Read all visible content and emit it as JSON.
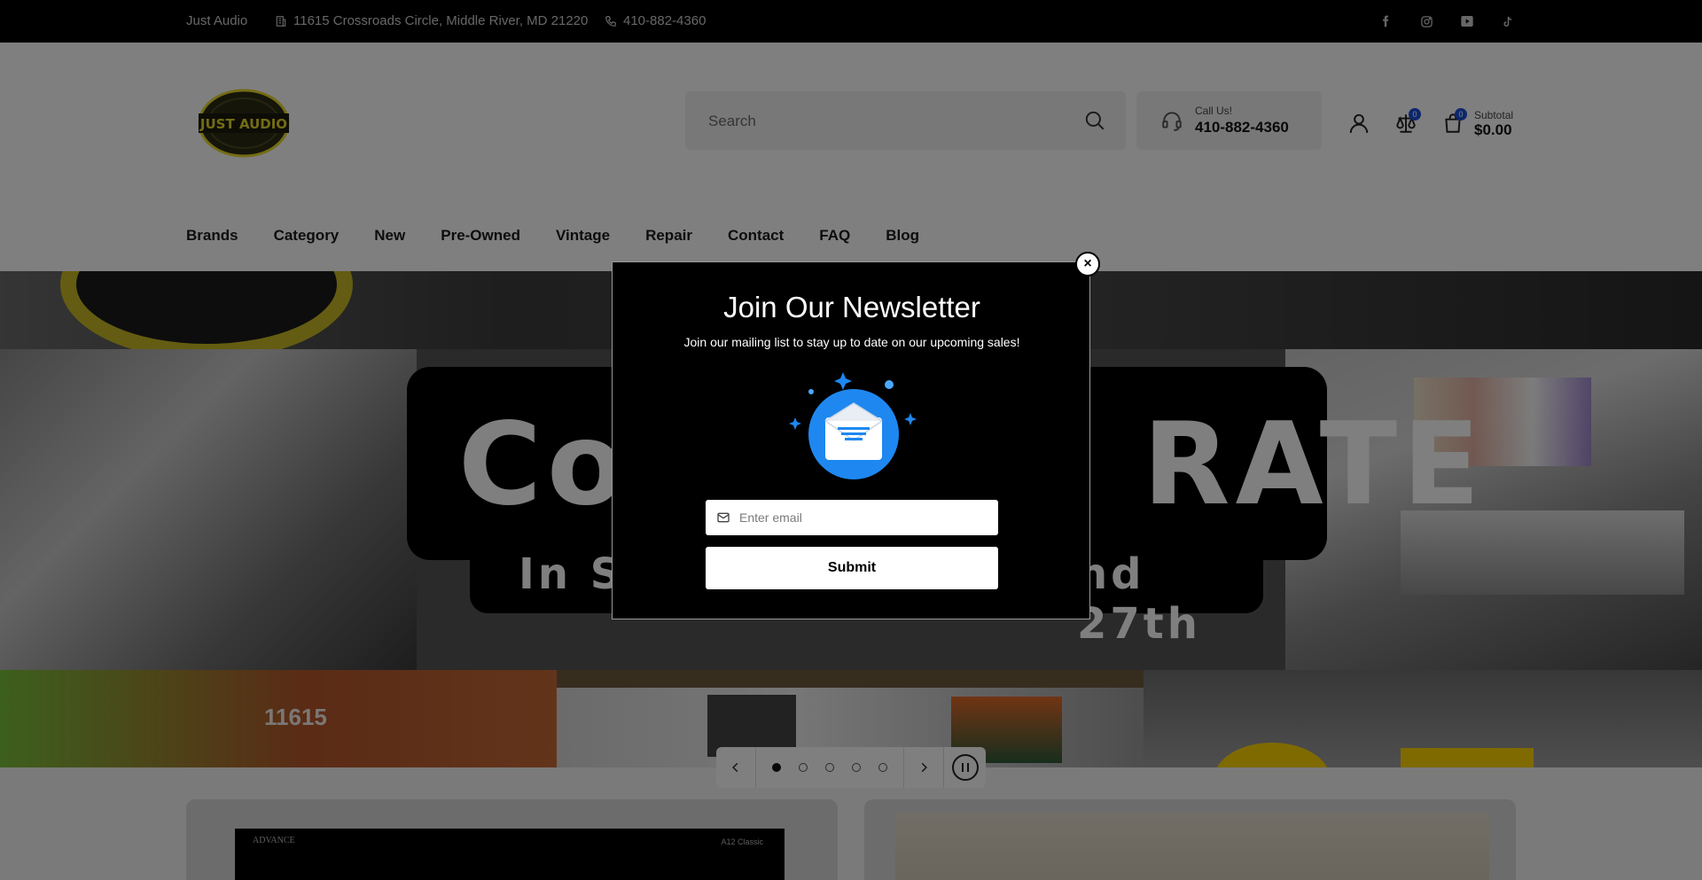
{
  "topbar": {
    "store_name": "Just Audio",
    "address": "11615 Crossroads Circle, Middle River, MD 21220",
    "phone": "410-882-4360",
    "socials": [
      "facebook-icon",
      "instagram-icon",
      "youtube-icon",
      "tiktok-icon"
    ]
  },
  "header": {
    "logo_text": "JUST AUDIO",
    "search_placeholder": "Search",
    "call_label": "Call Us!",
    "call_number": "410-882-4360",
    "compare_count": "0",
    "cart_count": "0",
    "subtotal_label": "Subtotal",
    "subtotal_value": "$0.00"
  },
  "nav": {
    "items": [
      "Brands",
      "Category",
      "New",
      "Pre-Owned",
      "Vintage",
      "Repair",
      "Contact",
      "FAQ",
      "Blog"
    ]
  },
  "hero": {
    "banner_big_left": "Com",
    "banner_big_right": "RATE",
    "banner_small_left": "In Sto",
    "banner_small_right": "nd 27th",
    "building_number": "11615",
    "slides": 5,
    "active_slide": 1
  },
  "products": {
    "card1_brand": "ADVANCE",
    "card1_model": "A12 Classic"
  },
  "modal": {
    "title": "Join Our Newsletter",
    "subtitle": "Join our mailing list to stay up to date on our upcoming sales!",
    "email_placeholder": "Enter email",
    "submit_label": "Submit",
    "close_label": "×"
  },
  "colors": {
    "topbar_bg": "#000000",
    "badge": "#1a4fd9",
    "envelope_blue": "#1e88f0",
    "logo_yellow": "#e8d82a"
  }
}
